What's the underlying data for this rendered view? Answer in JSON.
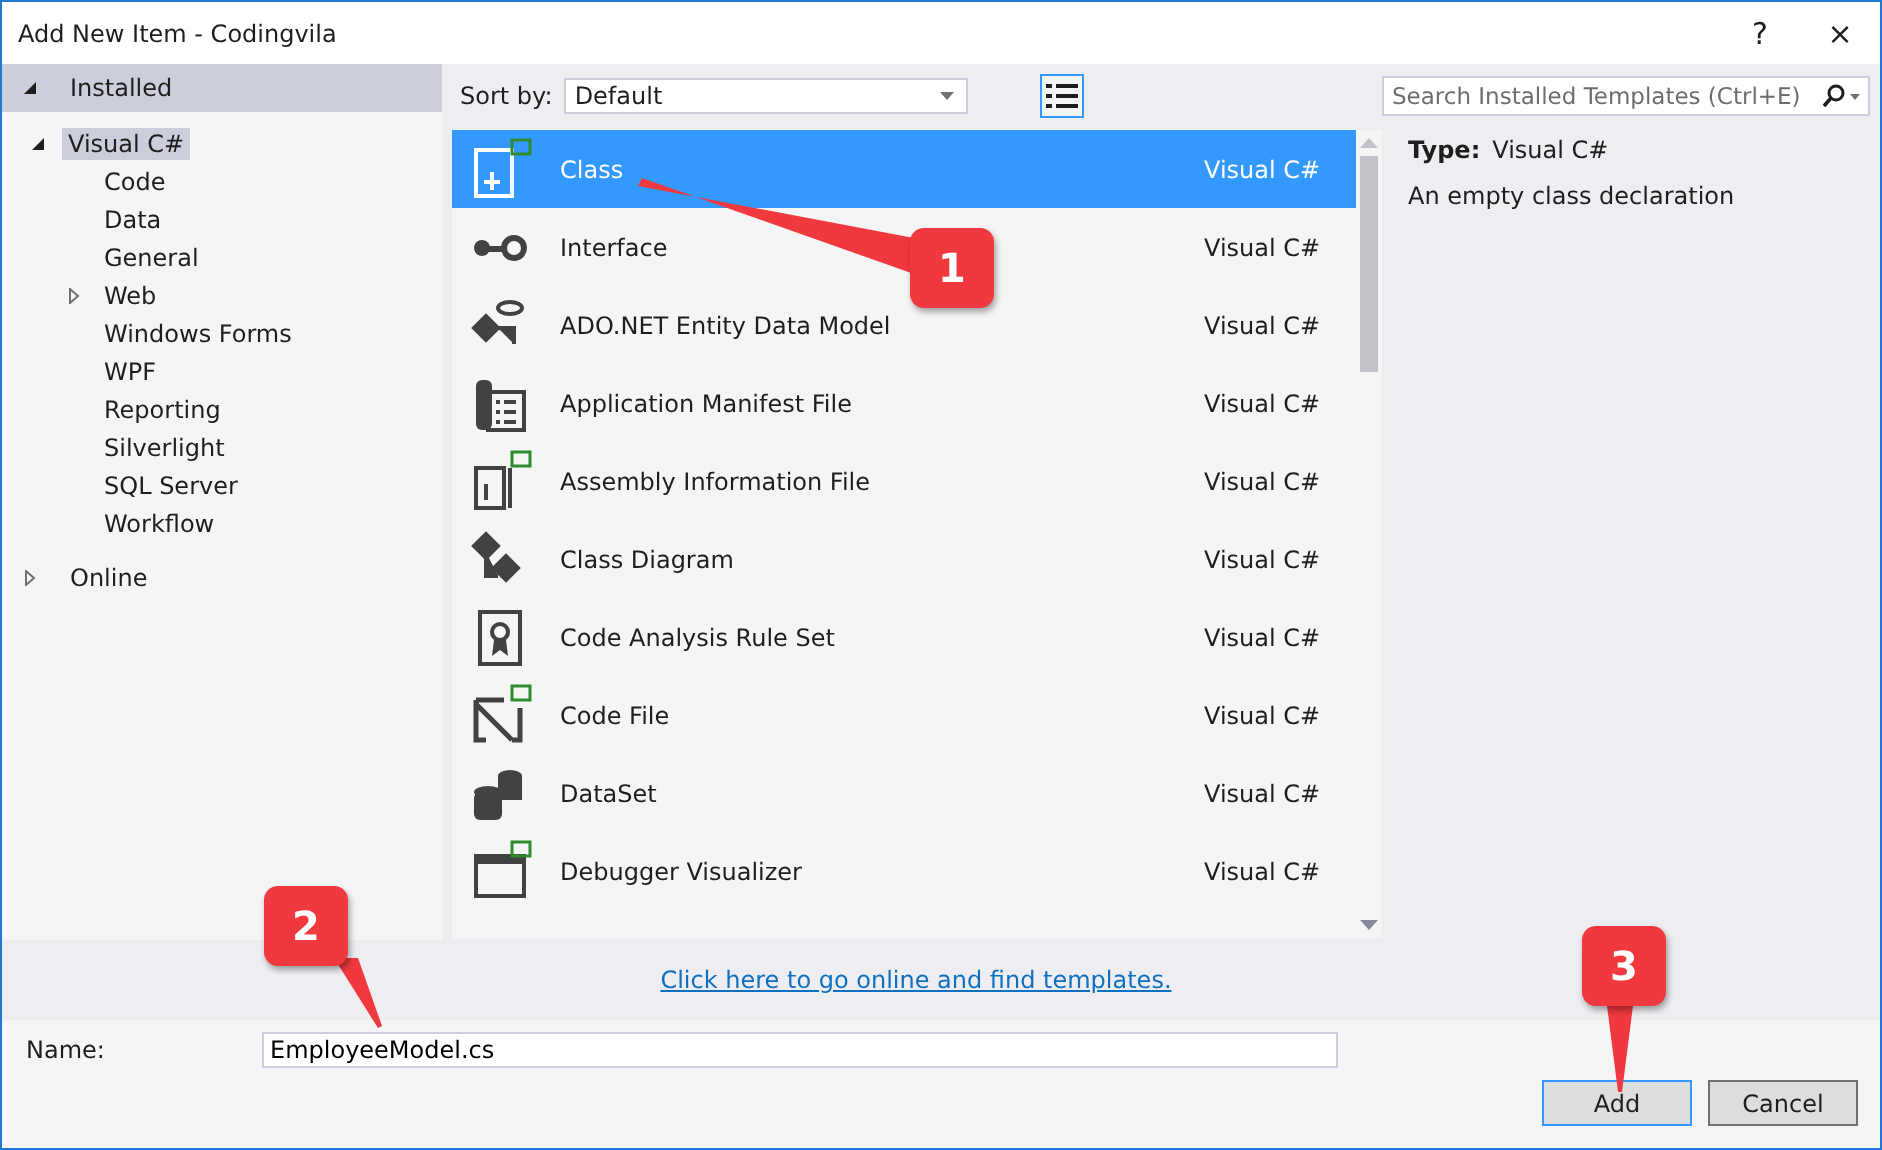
{
  "window": {
    "title": "Add New Item - Codingvila",
    "buttons": [
      "?",
      "×"
    ]
  },
  "sidebar": {
    "sections": [
      {
        "label": "Installed",
        "kind": "category",
        "expanded": true,
        "children": [
          {
            "label": "Visual C#",
            "selected": true,
            "expanded": true,
            "children": [
              {
                "label": "Code",
                "selected": false
              },
              {
                "label": "Data",
                "selected": false
              },
              {
                "label": "General",
                "selected": false
              },
              {
                "label": "Web",
                "selected": false,
                "expanded": false
              },
              {
                "label": "Windows Forms",
                "selected": false
              },
              {
                "label": "WPF",
                "selected": false
              },
              {
                "label": "Reporting",
                "selected": false
              },
              {
                "label": "Silverlight",
                "selected": false
              },
              {
                "label": "SQL Server",
                "selected": false
              },
              {
                "label": "Workflow",
                "selected": false
              }
            ]
          }
        ]
      },
      {
        "label": "Online",
        "kind": "node",
        "expanded": false
      }
    ]
  },
  "sort": {
    "label": "Sort by:",
    "value": "Default"
  },
  "search": {
    "placeholder": "Search Installed Templates (Ctrl+E)"
  },
  "templates": [
    {
      "name": "Class",
      "language": "Visual C#",
      "kind": "class",
      "selected": true
    },
    {
      "name": "Interface",
      "language": "Visual C#",
      "kind": "interface",
      "selected": false
    },
    {
      "name": "ADO.NET Entity Data Model",
      "language": "Visual C#",
      "kind": "entity",
      "selected": false
    },
    {
      "name": "Application Manifest File",
      "language": "Visual C#",
      "kind": "manifest",
      "selected": false
    },
    {
      "name": "Assembly Information File",
      "language": "Visual C#",
      "kind": "assembly",
      "selected": false
    },
    {
      "name": "Class Diagram",
      "language": "Visual C#",
      "kind": "diagram",
      "selected": false
    },
    {
      "name": "Code Analysis Rule Set",
      "language": "Visual C#",
      "kind": "ruleset",
      "selected": false
    },
    {
      "name": "Code File",
      "language": "Visual C#",
      "kind": "codefile",
      "selected": false
    },
    {
      "name": "DataSet",
      "language": "Visual C#",
      "kind": "dataset",
      "selected": false
    },
    {
      "name": "Debugger Visualizer",
      "language": "Visual C#",
      "kind": "visualizer",
      "selected": false
    }
  ],
  "details": {
    "type_label": "Type:",
    "type_value": "Visual C#",
    "description": "An empty class declaration"
  },
  "online_link": "Click here to go online and find templates.",
  "name_field": {
    "label": "Name:",
    "value": "EmployeeModel.cs"
  },
  "buttons": [
    {
      "label": "Add",
      "default": true
    },
    {
      "label": "Cancel",
      "default": false
    }
  ],
  "callouts": [
    {
      "label": "1"
    },
    {
      "label": "2"
    },
    {
      "label": "3"
    }
  ]
}
